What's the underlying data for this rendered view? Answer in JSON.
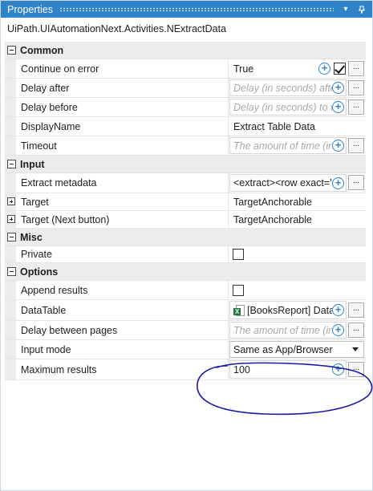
{
  "panel": {
    "title": "Properties"
  },
  "type_name": "UiPath.UIAutomationNext.Activities.NExtractData",
  "categories": [
    {
      "label": "Common",
      "properties": [
        {
          "name": "Continue on error",
          "value": "True",
          "checkbox_checked": true
        },
        {
          "name": "Delay after",
          "placeholder": "Delay (in seconds) after"
        },
        {
          "name": "Delay before",
          "placeholder": "Delay (in seconds) to wa"
        },
        {
          "name": "DisplayName",
          "value": "Extract Table Data"
        },
        {
          "name": "Timeout",
          "placeholder": "The amount of time (in s"
        }
      ]
    },
    {
      "label": "Input",
      "properties": [
        {
          "name": "Extract metadata",
          "value": "<extract><row exact='"
        },
        {
          "name": "Target",
          "value": "TargetAnchorable"
        },
        {
          "name": "Target (Next button)",
          "value": "TargetAnchorable"
        }
      ]
    },
    {
      "label": "Misc",
      "properties": [
        {
          "name": "Private",
          "checkbox_checked": false
        }
      ]
    },
    {
      "label": "Options",
      "properties": [
        {
          "name": "Append results",
          "checkbox_checked": false
        },
        {
          "name": "DataTable",
          "value": "[BooksReport] Data E"
        },
        {
          "name": "Delay between pages",
          "placeholder": "The amount of time (in s"
        },
        {
          "name": "Input mode",
          "value": "Same as App/Browser"
        },
        {
          "name": "Maximum results",
          "value": "100"
        }
      ]
    }
  ],
  "icons": {
    "titlebar_buttons": [
      "dropdown-arrow-icon",
      "pin-icon"
    ],
    "add_expression": "plus-circle-icon",
    "browse": "ellipsis-icon",
    "data_table": "excel-icon"
  },
  "colors": {
    "titlebar": "#2e83c9",
    "category_background": "#ececee",
    "annotation_ink": "#1a1aa8"
  }
}
